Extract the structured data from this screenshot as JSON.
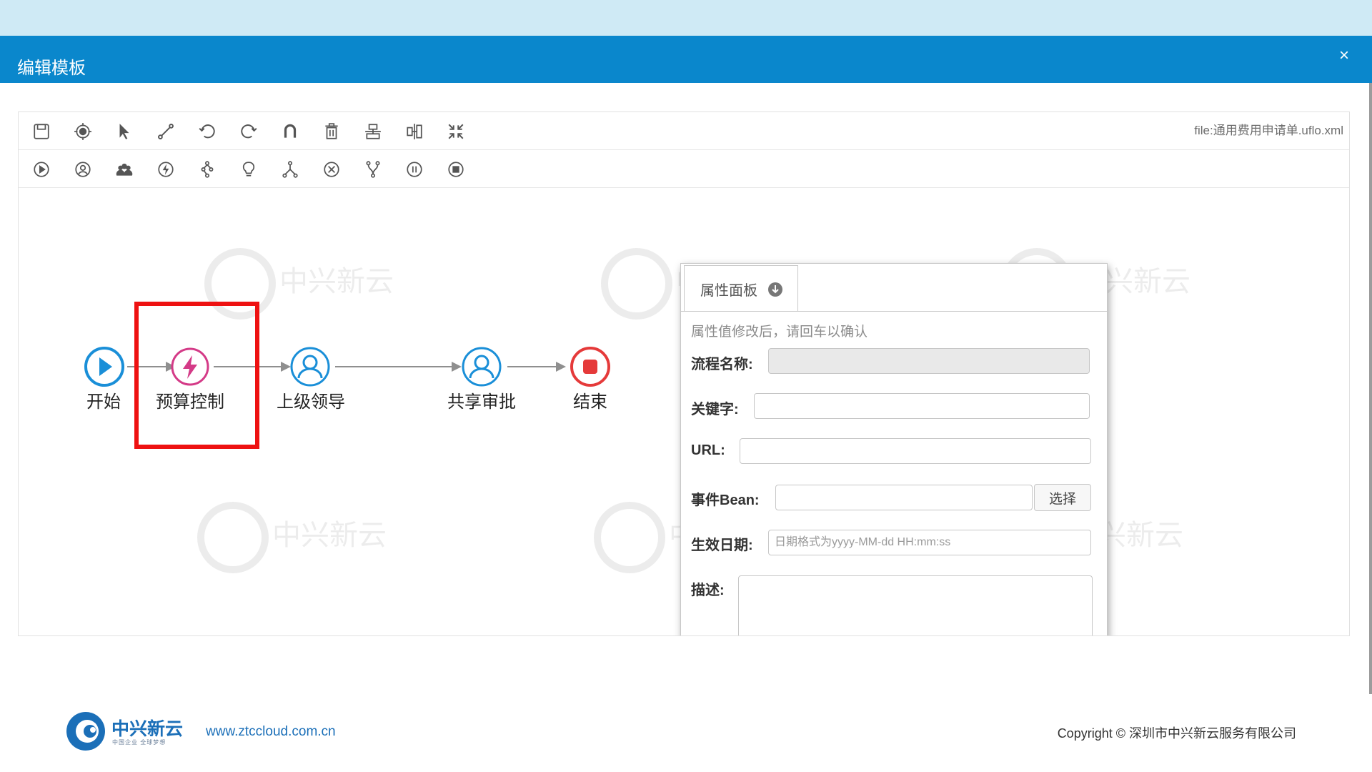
{
  "dialog": {
    "title": "编辑模板",
    "close_glyph": "×"
  },
  "toolbar": {
    "row1_icons": [
      "save-icon",
      "target-icon",
      "pointer-icon",
      "connector-icon",
      "undo-icon",
      "redo-icon",
      "magnet-icon",
      "delete-icon",
      "align-vertical-icon",
      "align-horizontal-icon",
      "compress-icon"
    ],
    "row2_icons": [
      "start-node-icon",
      "user-task-icon",
      "group-task-icon",
      "action-node-icon",
      "fork-node-icon",
      "decision-node-icon",
      "join-node-icon",
      "cancel-node-icon",
      "subflow-node-icon",
      "pause-node-icon",
      "end-node-icon"
    ],
    "filename": "file:通用费用申请单.uflo.xml"
  },
  "flow": {
    "nodes": [
      {
        "id": "start",
        "label": "开始",
        "icon": "play-icon",
        "color": "#1a8fd8"
      },
      {
        "id": "budget",
        "label": "预算控制",
        "icon": "lightning-icon",
        "color": "#d43a87"
      },
      {
        "id": "leader",
        "label": "上级领导",
        "icon": "user-icon",
        "color": "#1a8fd8"
      },
      {
        "id": "share",
        "label": "共享审批",
        "icon": "user-icon",
        "color": "#1a8fd8"
      },
      {
        "id": "end",
        "label": "结束",
        "icon": "stop-icon",
        "color": "#e53a3a"
      }
    ],
    "highlight_color": "#ee1111"
  },
  "panel": {
    "tab_label": "属性面板",
    "tab_icon": "arrow-down-circle-icon",
    "hint": "属性值修改后，请回车以确认",
    "fields": {
      "process_name": {
        "label": "流程名称:",
        "value": ""
      },
      "keyword": {
        "label": "关键字:",
        "value": ""
      },
      "url": {
        "label": "URL:",
        "value": ""
      },
      "event_bean": {
        "label": "事件Bean:",
        "value": "",
        "button": "选择"
      },
      "effective_date": {
        "label": "生效日期:",
        "placeholder": "日期格式为yyyy-MM-dd HH:mm:ss"
      },
      "description": {
        "label": "描述:",
        "value": ""
      }
    }
  },
  "footer": {
    "brand": "中兴新云",
    "brand_sub": "中国企业 全球梦想",
    "website": "www.ztccloud.com.cn",
    "copyright": "Copyright © 深圳市中兴新云服务有限公司"
  },
  "watermark": {
    "text": "中兴新云"
  },
  "colors": {
    "title_bar": "#0a87cc",
    "top_band": "#cfeaf5",
    "brand_blue": "#1b6fb8"
  }
}
